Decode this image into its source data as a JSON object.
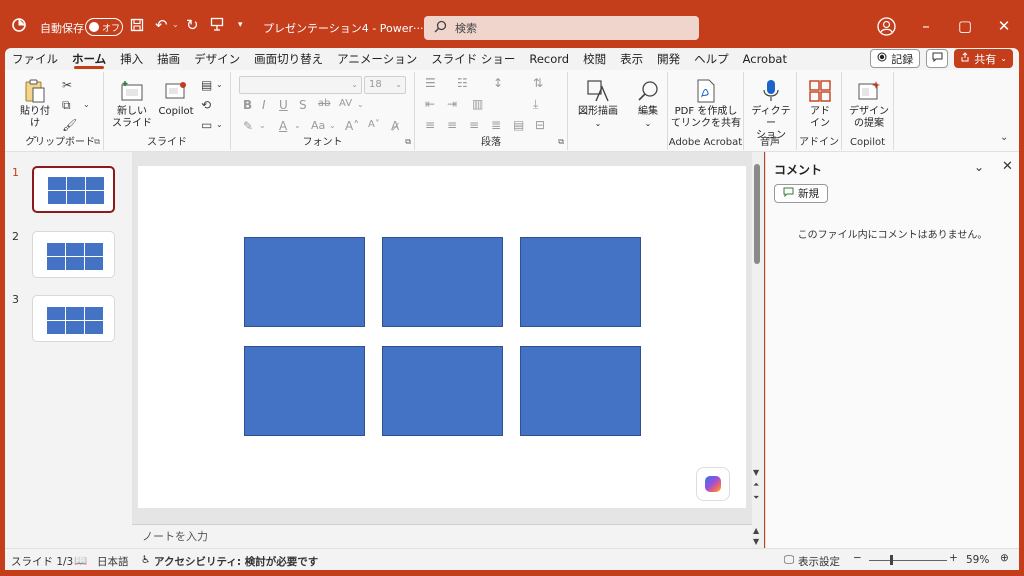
{
  "titlebar": {
    "autosave_label": "自動保存",
    "toggle_state": "オフ",
    "doc_title": "プレゼンテーション4 - Power···",
    "search_placeholder": "検索"
  },
  "menu": {
    "tabs": [
      "ファイル",
      "ホーム",
      "挿入",
      "描画",
      "デザイン",
      "画面切り替え",
      "アニメーション",
      "スライド ショー",
      "Record",
      "校閲",
      "表示",
      "開発",
      "ヘルプ",
      "Acrobat"
    ],
    "active_tab": "ホーム",
    "record_label": "記録",
    "share_label": "共有"
  },
  "ribbon": {
    "groups": {
      "clipboard": "クリップボード",
      "slides": "スライド",
      "font": "フォント",
      "paragraph": "段落",
      "adobe": "Adobe Acrobat",
      "voice": "音声",
      "addins": "アドイン",
      "copilot": "Copilot"
    },
    "buttons": {
      "paste": "貼り付け",
      "new_slide_1": "新しい",
      "new_slide_2": "スライド",
      "copilot": "Copilot",
      "shapes": "図形描画",
      "edit": "編集",
      "pdf_1": "PDF を作成し",
      "pdf_2": "てリンクを共有",
      "dictate_1": "ディクテー",
      "dictate_2": "ション",
      "addin_1": "アド",
      "addin_2": "イン",
      "designer_1": "デザイン",
      "designer_2": "の提案"
    },
    "font_size": "18"
  },
  "slides_panel": {
    "slides": [
      {
        "num": "1",
        "active": true
      },
      {
        "num": "2",
        "active": false
      },
      {
        "num": "3",
        "active": false
      }
    ]
  },
  "notes_placeholder": "ノートを入力",
  "comments": {
    "title": "コメント",
    "new_label": "新規",
    "empty_text": "このファイル内にコメントはありません。"
  },
  "statusbar": {
    "slide_counter": "スライド 1/3",
    "language": "日本語",
    "accessibility": "アクセシビリティ: 検討が必要です",
    "display_settings": "表示設定",
    "zoom": "59%"
  },
  "colors": {
    "accent": "#c43e1c",
    "shape_fill": "#4472c4",
    "active_thumb_border": "#8b1a1a"
  }
}
